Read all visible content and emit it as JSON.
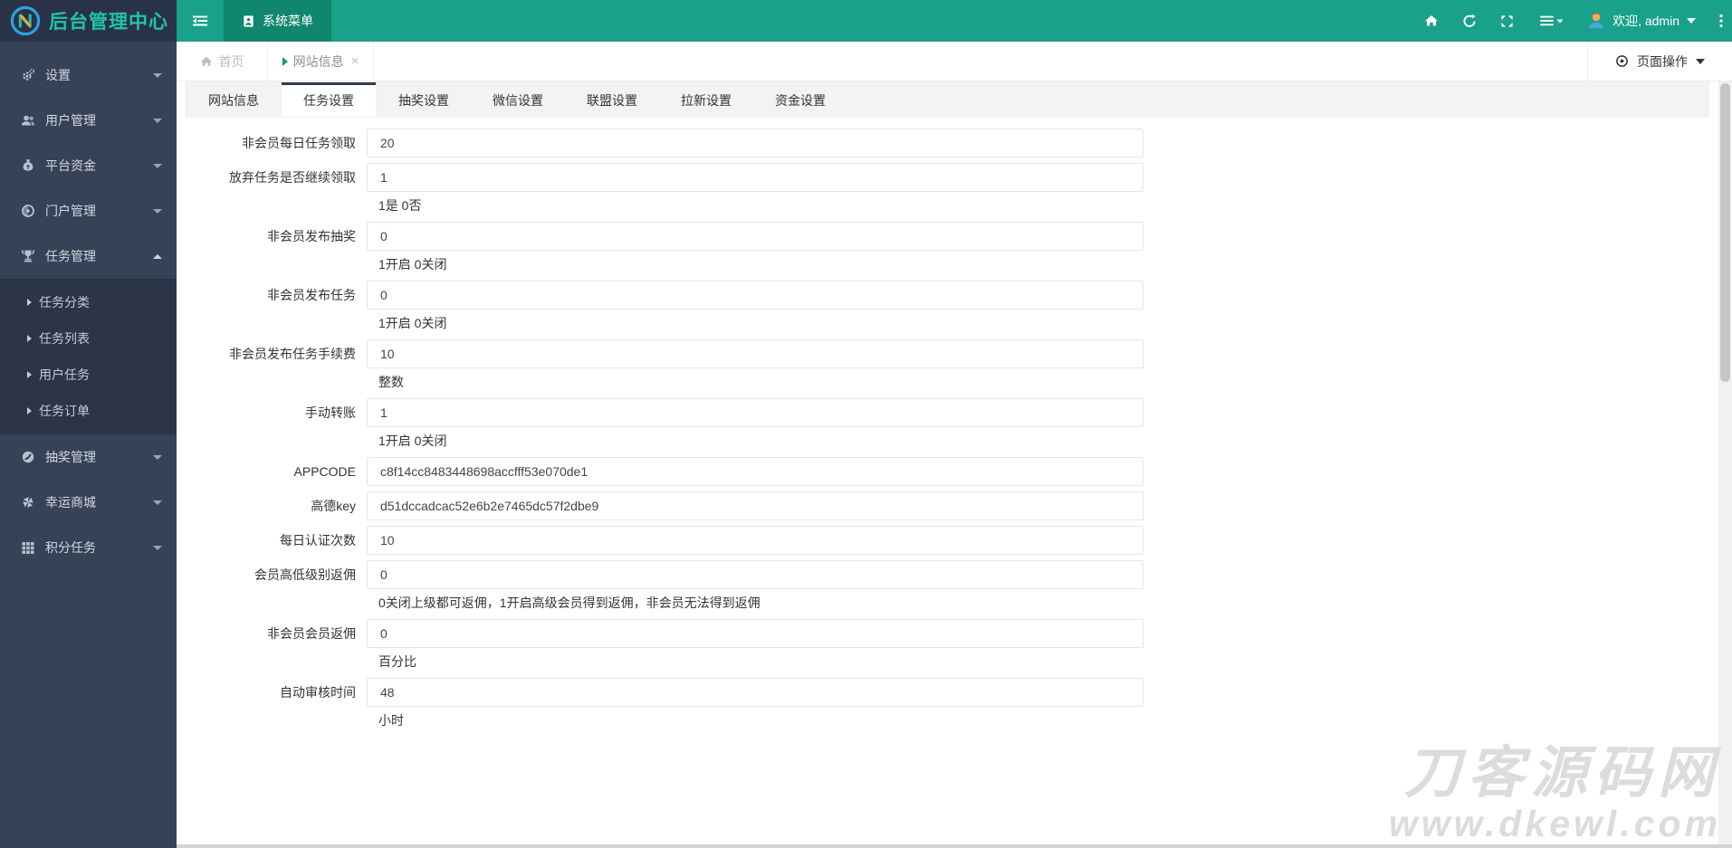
{
  "topbar": {
    "title": "后台管理中心",
    "system_menu_label": "系统菜单",
    "welcome_label": "欢迎, admin"
  },
  "breadcrumb": {
    "home_label": "首页",
    "tab_label": "网站信息",
    "close_glyph": "×",
    "page_actions_label": "页面操作"
  },
  "sidebar": {
    "items": [
      {
        "key": "settings",
        "icon": "gear-icon",
        "label": "设置",
        "expanded": false
      },
      {
        "key": "user-management",
        "icon": "users-icon",
        "label": "用户管理",
        "expanded": false
      },
      {
        "key": "platform-funds",
        "icon": "moneybag-icon",
        "label": "平台资金",
        "expanded": false
      },
      {
        "key": "portal-management",
        "icon": "portal-icon",
        "label": "门户管理",
        "expanded": false
      },
      {
        "key": "task-management",
        "icon": "task-icon",
        "label": "任务管理",
        "expanded": true,
        "children": [
          {
            "key": "task-category",
            "label": "任务分类"
          },
          {
            "key": "task-list",
            "label": "任务列表"
          },
          {
            "key": "user-task",
            "label": "用户任务"
          },
          {
            "key": "task-order",
            "label": "任务订单"
          }
        ]
      },
      {
        "key": "lottery-management",
        "icon": "lottery-icon",
        "label": "抽奖管理",
        "expanded": false
      },
      {
        "key": "lucky-mall",
        "icon": "mall-icon",
        "label": "幸运商城",
        "expanded": false
      },
      {
        "key": "points-task",
        "icon": "grid-icon",
        "label": "积分任务",
        "expanded": false
      }
    ]
  },
  "tabs": {
    "active_index": 1,
    "items": [
      "网站信息",
      "任务设置",
      "抽奖设置",
      "微信设置",
      "联盟设置",
      "拉新设置",
      "资金设置"
    ]
  },
  "form": {
    "rows": [
      {
        "label": "非会员每日任务领取",
        "value": "20",
        "hint": ""
      },
      {
        "label": "放弃任务是否继续领取",
        "value": "1",
        "hint": "1是 0否"
      },
      {
        "label": "非会员发布抽奖",
        "value": "0",
        "hint": "1开启 0关闭"
      },
      {
        "label": "非会员发布任务",
        "value": "0",
        "hint": "1开启 0关闭"
      },
      {
        "label": "非会员发布任务手续费",
        "value": "10",
        "hint": "整数"
      },
      {
        "label": "手动转账",
        "value": "1",
        "hint": "1开启 0关闭"
      },
      {
        "label": "APPCODE",
        "value": "c8f14cc8483448698accfff53e070de1",
        "hint": ""
      },
      {
        "label": "高德key",
        "value": "d51dccadcac52e6b2e7465dc57f2dbe9",
        "hint": ""
      },
      {
        "label": "每日认证次数",
        "value": "10",
        "hint": ""
      },
      {
        "label": "会员高低级别返佣",
        "value": "0",
        "hint": "0关闭上级都可返佣，1开启高级会员得到返佣，非会员无法得到返佣"
      },
      {
        "label": "非会员会员返佣",
        "value": "0",
        "hint": "百分比"
      },
      {
        "label": "自动审核时间",
        "value": "48",
        "hint": "小时"
      }
    ]
  },
  "watermark": {
    "line1": "刀客源码网",
    "line2": "www.dkewl.com"
  },
  "colors": {
    "topbar_teal": "#19a189",
    "system_menu_teal": "#11866f",
    "logo_bg": "#2a3248",
    "sidebar_bg": "#364257",
    "submenu_bg": "#2b3547",
    "title_teal": "#1fc5a5",
    "active_tab_border": "#2f3a4a",
    "breadcrumb_caret": "#149b82"
  }
}
